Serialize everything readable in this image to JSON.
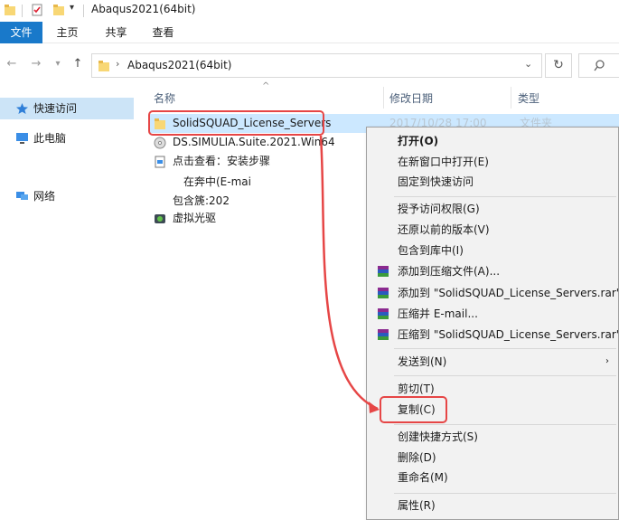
{
  "window": {
    "title": "Abaqus2021(64bit)"
  },
  "ribbon": {
    "tabs": [
      "文件",
      "主页",
      "共享",
      "查看"
    ]
  },
  "address": {
    "path": "Abaqus2021(64bit)"
  },
  "sidebar": {
    "items": [
      {
        "label": "快速访问",
        "icon": "star-pin-icon"
      },
      {
        "label": "此电脑",
        "icon": "computer-icon"
      },
      {
        "label": "网络",
        "icon": "network-icon"
      }
    ]
  },
  "columns": {
    "name": "名称",
    "date": "修改日期",
    "type": "类型"
  },
  "files": [
    {
      "name": "SolidSQUAD_License_Servers",
      "date": "2017/10/28 17:00",
      "type": "文件夹",
      "icon": "folder-icon"
    },
    {
      "name": "DS.SIMULIA.Suite.2021.Win64",
      "icon": "disc-image-icon"
    },
    {
      "name": "点击查看：安装步骤",
      "icon": "document-icon"
    },
    {
      "name": "在奔中(E-mai",
      "icon": "none"
    },
    {
      "name": "包含篪:202",
      "icon": "none"
    },
    {
      "name": "虚拟光驱",
      "icon": "virtual-drive-icon"
    }
  ],
  "context_menu": {
    "items": [
      {
        "label": "打开(O)",
        "bold": true
      },
      {
        "label": "在新窗口中打开(E)"
      },
      {
        "label": "固定到快速访问"
      },
      {
        "label": "授予访问权限(G)"
      },
      {
        "label": "还原以前的版本(V)"
      },
      {
        "label": "包含到库中(I)"
      },
      {
        "label": "添加到压缩文件(A)...",
        "icon": "winrar-icon"
      },
      {
        "label": "添加到 \"SolidSQUAD_License_Servers.rar\"(T",
        "icon": "winrar-icon"
      },
      {
        "label": "压缩并 E-mail...",
        "icon": "winrar-icon"
      },
      {
        "label": "压缩到 \"SolidSQUAD_License_Servers.rar\" 并",
        "icon": "winrar-icon"
      },
      {
        "label": "发送到(N)"
      },
      {
        "label": "剪切(T)"
      },
      {
        "label": "复制(C)"
      },
      {
        "label": "创建快捷方式(S)"
      },
      {
        "label": "删除(D)"
      },
      {
        "label": "重命名(M)"
      },
      {
        "label": "属性(R)"
      }
    ]
  },
  "colors": {
    "accent": "#1979ca",
    "selection": "#cce8ff",
    "annotation": "#e64646"
  }
}
